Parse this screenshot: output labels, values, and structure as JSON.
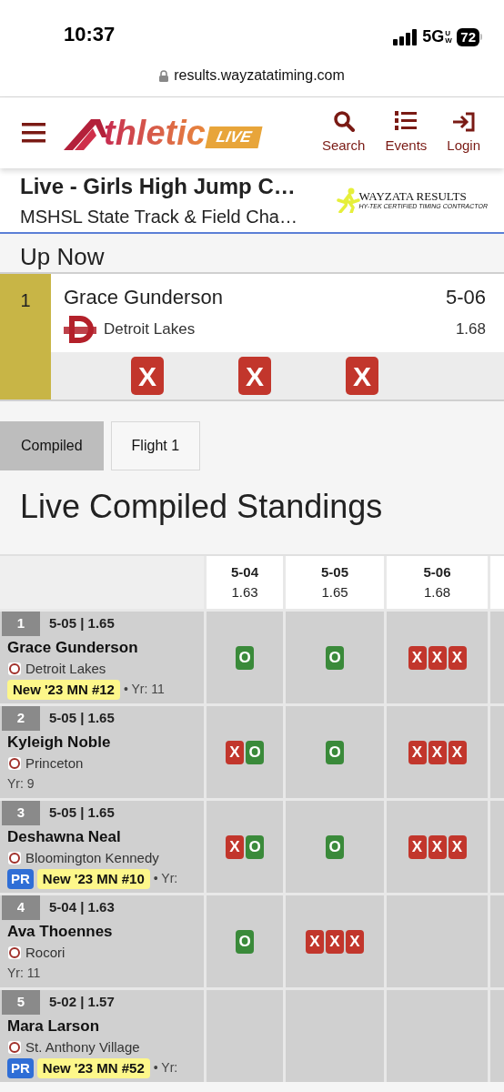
{
  "status_bar": {
    "time": "10:37",
    "network": "5G",
    "network_sub": "UW",
    "battery": "72"
  },
  "address_bar": {
    "url": "results.wayzatatiming.com"
  },
  "header": {
    "logo_text": "thletic",
    "logo_badge": "LIVE",
    "nav": [
      {
        "label": "Search",
        "kind": "search"
      },
      {
        "label": "Events",
        "kind": "events"
      },
      {
        "label": "Login",
        "kind": "login"
      }
    ]
  },
  "event": {
    "title": "Live - Girls High Jump C…",
    "subtitle": "MSHSL State Track & Field Cha…",
    "sponsor": "WAYZATA RESULTS",
    "sponsor_tagline": "HY-TEK CERTIFIED TIMING CONTRACTOR"
  },
  "up_now": {
    "heading": "Up Now",
    "place": "1",
    "name": "Grace Gunderson",
    "team": "Detroit Lakes",
    "mark": "5-06",
    "metric": "1.68",
    "attempts": [
      {
        "text": "X",
        "kind": "miss"
      },
      {
        "text": "X",
        "kind": "miss"
      },
      {
        "text": "X",
        "kind": "miss"
      }
    ]
  },
  "tabs": [
    {
      "label": "Compiled",
      "selected": true
    },
    {
      "label": "Flight 1",
      "selected": false
    }
  ],
  "standings": {
    "title": "Live Compiled Standings",
    "heights": [
      {
        "mark": "5-04",
        "metric": "1.63"
      },
      {
        "mark": "5-05",
        "metric": "1.65"
      },
      {
        "mark": "5-06",
        "metric": "1.68"
      }
    ],
    "rows": [
      {
        "place": "1",
        "best": "5-05 | 1.65",
        "name": "Grace Gunderson",
        "team": "Detroit Lakes",
        "record": "New '23 MN #12",
        "year": "• Yr: 11",
        "attempts": [
          [
            {
              "text": "O",
              "kind": "clear"
            }
          ],
          [
            {
              "text": "O",
              "kind": "clear"
            }
          ],
          [
            {
              "text": "X",
              "kind": "miss"
            },
            {
              "text": "X",
              "kind": "miss"
            },
            {
              "text": "X",
              "kind": "miss"
            }
          ]
        ]
      },
      {
        "place": "2",
        "best": "5-05 | 1.65",
        "name": "Kyleigh Noble",
        "team": "Princeton",
        "year": "Yr: 9",
        "attempts": [
          [
            {
              "text": "X",
              "kind": "miss"
            },
            {
              "text": "O",
              "kind": "clear"
            }
          ],
          [
            {
              "text": "O",
              "kind": "clear"
            }
          ],
          [
            {
              "text": "X",
              "kind": "miss"
            },
            {
              "text": "X",
              "kind": "miss"
            },
            {
              "text": "X",
              "kind": "miss"
            }
          ]
        ]
      },
      {
        "place": "3",
        "best": "5-05 | 1.65",
        "name": "Deshawna Neal",
        "team": "Bloomington Kennedy",
        "pr_label": "PR",
        "record": "New '23 MN #10",
        "year": "• Yr:",
        "attempts": [
          [
            {
              "text": "X",
              "kind": "miss"
            },
            {
              "text": "O",
              "kind": "clear"
            }
          ],
          [
            {
              "text": "O",
              "kind": "clear"
            }
          ],
          [
            {
              "text": "X",
              "kind": "miss"
            },
            {
              "text": "X",
              "kind": "miss"
            },
            {
              "text": "X",
              "kind": "miss"
            }
          ]
        ]
      },
      {
        "place": "4",
        "best": "5-04 | 1.63",
        "name": "Ava Thoennes",
        "team": "Rocori",
        "year": "Yr: 11",
        "attempts": [
          [
            {
              "text": "O",
              "kind": "clear"
            }
          ],
          [
            {
              "text": "X",
              "kind": "miss"
            },
            {
              "text": "X",
              "kind": "miss"
            },
            {
              "text": "X",
              "kind": "miss"
            }
          ]
        ]
      },
      {
        "place": "5",
        "best": "5-02 | 1.57",
        "name": "Mara Larson",
        "team": "St. Anthony Village",
        "pr_label": "PR",
        "record": "New '23 MN #52",
        "year": "• Yr:"
      }
    ]
  }
}
